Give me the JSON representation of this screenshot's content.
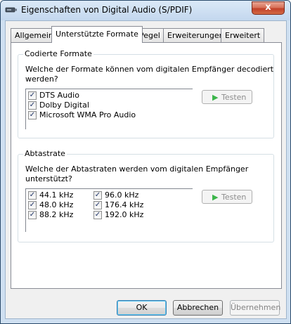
{
  "window": {
    "title": "Eigenschaften von Digital Audio (S/PDIF)",
    "close_glyph": "x"
  },
  "tabs": [
    {
      "label": "Allgemein",
      "active": false
    },
    {
      "label": "Unterstützte Formate",
      "active": true
    },
    {
      "label": "Pegel",
      "active": false
    },
    {
      "label": "Erweiterungen",
      "active": false
    },
    {
      "label": "Erweitert",
      "active": false
    }
  ],
  "encoded_formats": {
    "title": "Codierte Formate",
    "question_line1": "Welche der Formate können vom digitalen Empfänger decodiert",
    "question_line2": "werden?",
    "items": [
      {
        "label": "DTS Audio",
        "checked": true
      },
      {
        "label": "Dolby Digital",
        "checked": true
      },
      {
        "label": "Microsoft WMA Pro Audio",
        "checked": true
      }
    ],
    "test_label": "Testen",
    "test_enabled": false
  },
  "sample_rates": {
    "title": "Abtastrate",
    "question_line1": "Welche der Abtastraten werden vom digitalen Empfänger",
    "question_line2": "unterstützt?",
    "items": [
      {
        "label": "44.1 kHz",
        "checked": true
      },
      {
        "label": "48.0 kHz",
        "checked": true
      },
      {
        "label": "88.2 kHz",
        "checked": true
      },
      {
        "label": "96.0 kHz",
        "checked": true
      },
      {
        "label": "176.4 kHz",
        "checked": true
      },
      {
        "label": "192.0 kHz",
        "checked": true
      }
    ],
    "test_label": "Testen",
    "test_enabled": false
  },
  "buttons": {
    "ok": "OK",
    "cancel": "Abbrechen",
    "apply": "Übernehmen",
    "apply_enabled": false
  },
  "check_glyph": "✓",
  "play_glyph": "▶",
  "colors": {
    "play_icon": "#3bb54a",
    "title_bar": "#c3d7ee",
    "close_button": "#c2412a"
  },
  "icons": {
    "title": "speaker-icon",
    "test": "play-icon"
  }
}
